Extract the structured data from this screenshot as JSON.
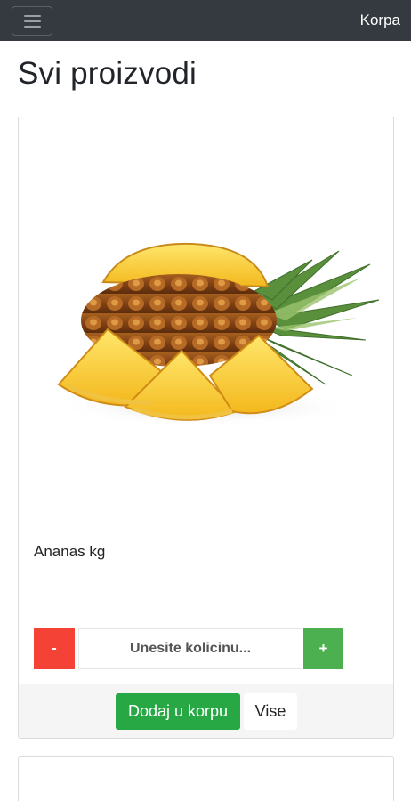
{
  "navbar": {
    "menu_icon": "hamburger-icon",
    "cart_link": "Korpa",
    "background": "#343a40"
  },
  "page": {
    "title": "Svi proizvodi"
  },
  "products": [
    {
      "name": "Ananas kg",
      "image": "pineapple-image",
      "quantity": {
        "minus_label": "-",
        "placeholder": "Unesite kolicinu...",
        "value": "",
        "plus_label": "+"
      },
      "actions": {
        "add_label": "Dodaj u korpu",
        "more_label": "Vise"
      }
    }
  ],
  "colors": {
    "minus": "#f44336",
    "plus": "#4caf50",
    "add_to_cart": "#28a745",
    "footer": "#f5f5f5"
  }
}
